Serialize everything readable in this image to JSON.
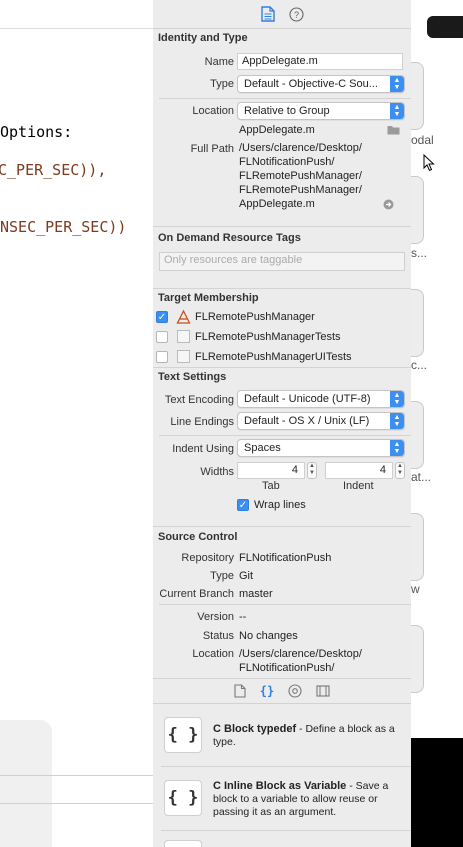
{
  "editor": {
    "lines": [
      {
        "text": "Options:"
      },
      {
        "text": "C_PER_SEC)),"
      },
      {
        "text": " NSEC_PER_SEC))"
      }
    ]
  },
  "simulator": {
    "labels": [
      "odal",
      "s...",
      "c...",
      "at...",
      "w"
    ]
  },
  "inspector": {
    "tabs": [
      "file-icon",
      "help-icon"
    ],
    "identity": {
      "title": "Identity and Type",
      "name_label": "Name",
      "name_value": "AppDelegate.m",
      "type_label": "Type",
      "type_value": "Default - Objective-C Sou...",
      "location_label": "Location",
      "location_value": "Relative to Group",
      "location_file": "AppDelegate.m",
      "fullpath_label": "Full Path",
      "fullpath_lines": [
        "/Users/clarence/Desktop/",
        "FLNotificationPush/",
        "FLRemotePushManager/",
        "FLRemotePushManager/",
        "AppDelegate.m"
      ]
    },
    "ondemand": {
      "title": "On Demand Resource Tags",
      "placeholder": "Only resources are taggable"
    },
    "target": {
      "title": "Target Membership",
      "items": [
        {
          "label": "FLRemotePushManager",
          "checked": true
        },
        {
          "label": "FLRemotePushManagerTests",
          "checked": false
        },
        {
          "label": "FLRemotePushManagerUITests",
          "checked": false
        }
      ]
    },
    "text": {
      "title": "Text Settings",
      "encoding_label": "Text Encoding",
      "encoding_value": "Default - Unicode (UTF-8)",
      "endings_label": "Line Endings",
      "endings_value": "Default - OS X / Unix (LF)",
      "indent_label": "Indent Using",
      "indent_value": "Spaces",
      "widths_label": "Widths",
      "tab_value": "4",
      "indent_width_value": "4",
      "tab_label": "Tab",
      "indent_sub_label": "Indent",
      "wrap_label": "Wrap lines",
      "wrap_checked": true
    },
    "source": {
      "title": "Source Control",
      "repo_label": "Repository",
      "repo_value": "FLNotificationPush",
      "type_label": "Type",
      "type_value": "Git",
      "branch_label": "Current Branch",
      "branch_value": "master",
      "version_label": "Version",
      "version_value": "--",
      "status_label": "Status",
      "status_value": "No changes",
      "location_label": "Location",
      "location_lines": [
        "/Users/clarence/Desktop/",
        "FLNotificationPush/"
      ]
    },
    "library": {
      "tabs": [
        "file-template-icon",
        "code-snippet-icon",
        "object-icon",
        "media-icon"
      ],
      "items": [
        {
          "icon": "{ }",
          "title": "C Block typedef",
          "desc": " - Define a block as a type."
        },
        {
          "icon": "{ }",
          "title": "C Inline Block as Variable",
          "desc": " - Save a block to a variable to allow reuse or passing it as an argument."
        }
      ]
    }
  },
  "colors": {
    "accent": "#3b8ff2",
    "macro": "#7c3b20"
  }
}
